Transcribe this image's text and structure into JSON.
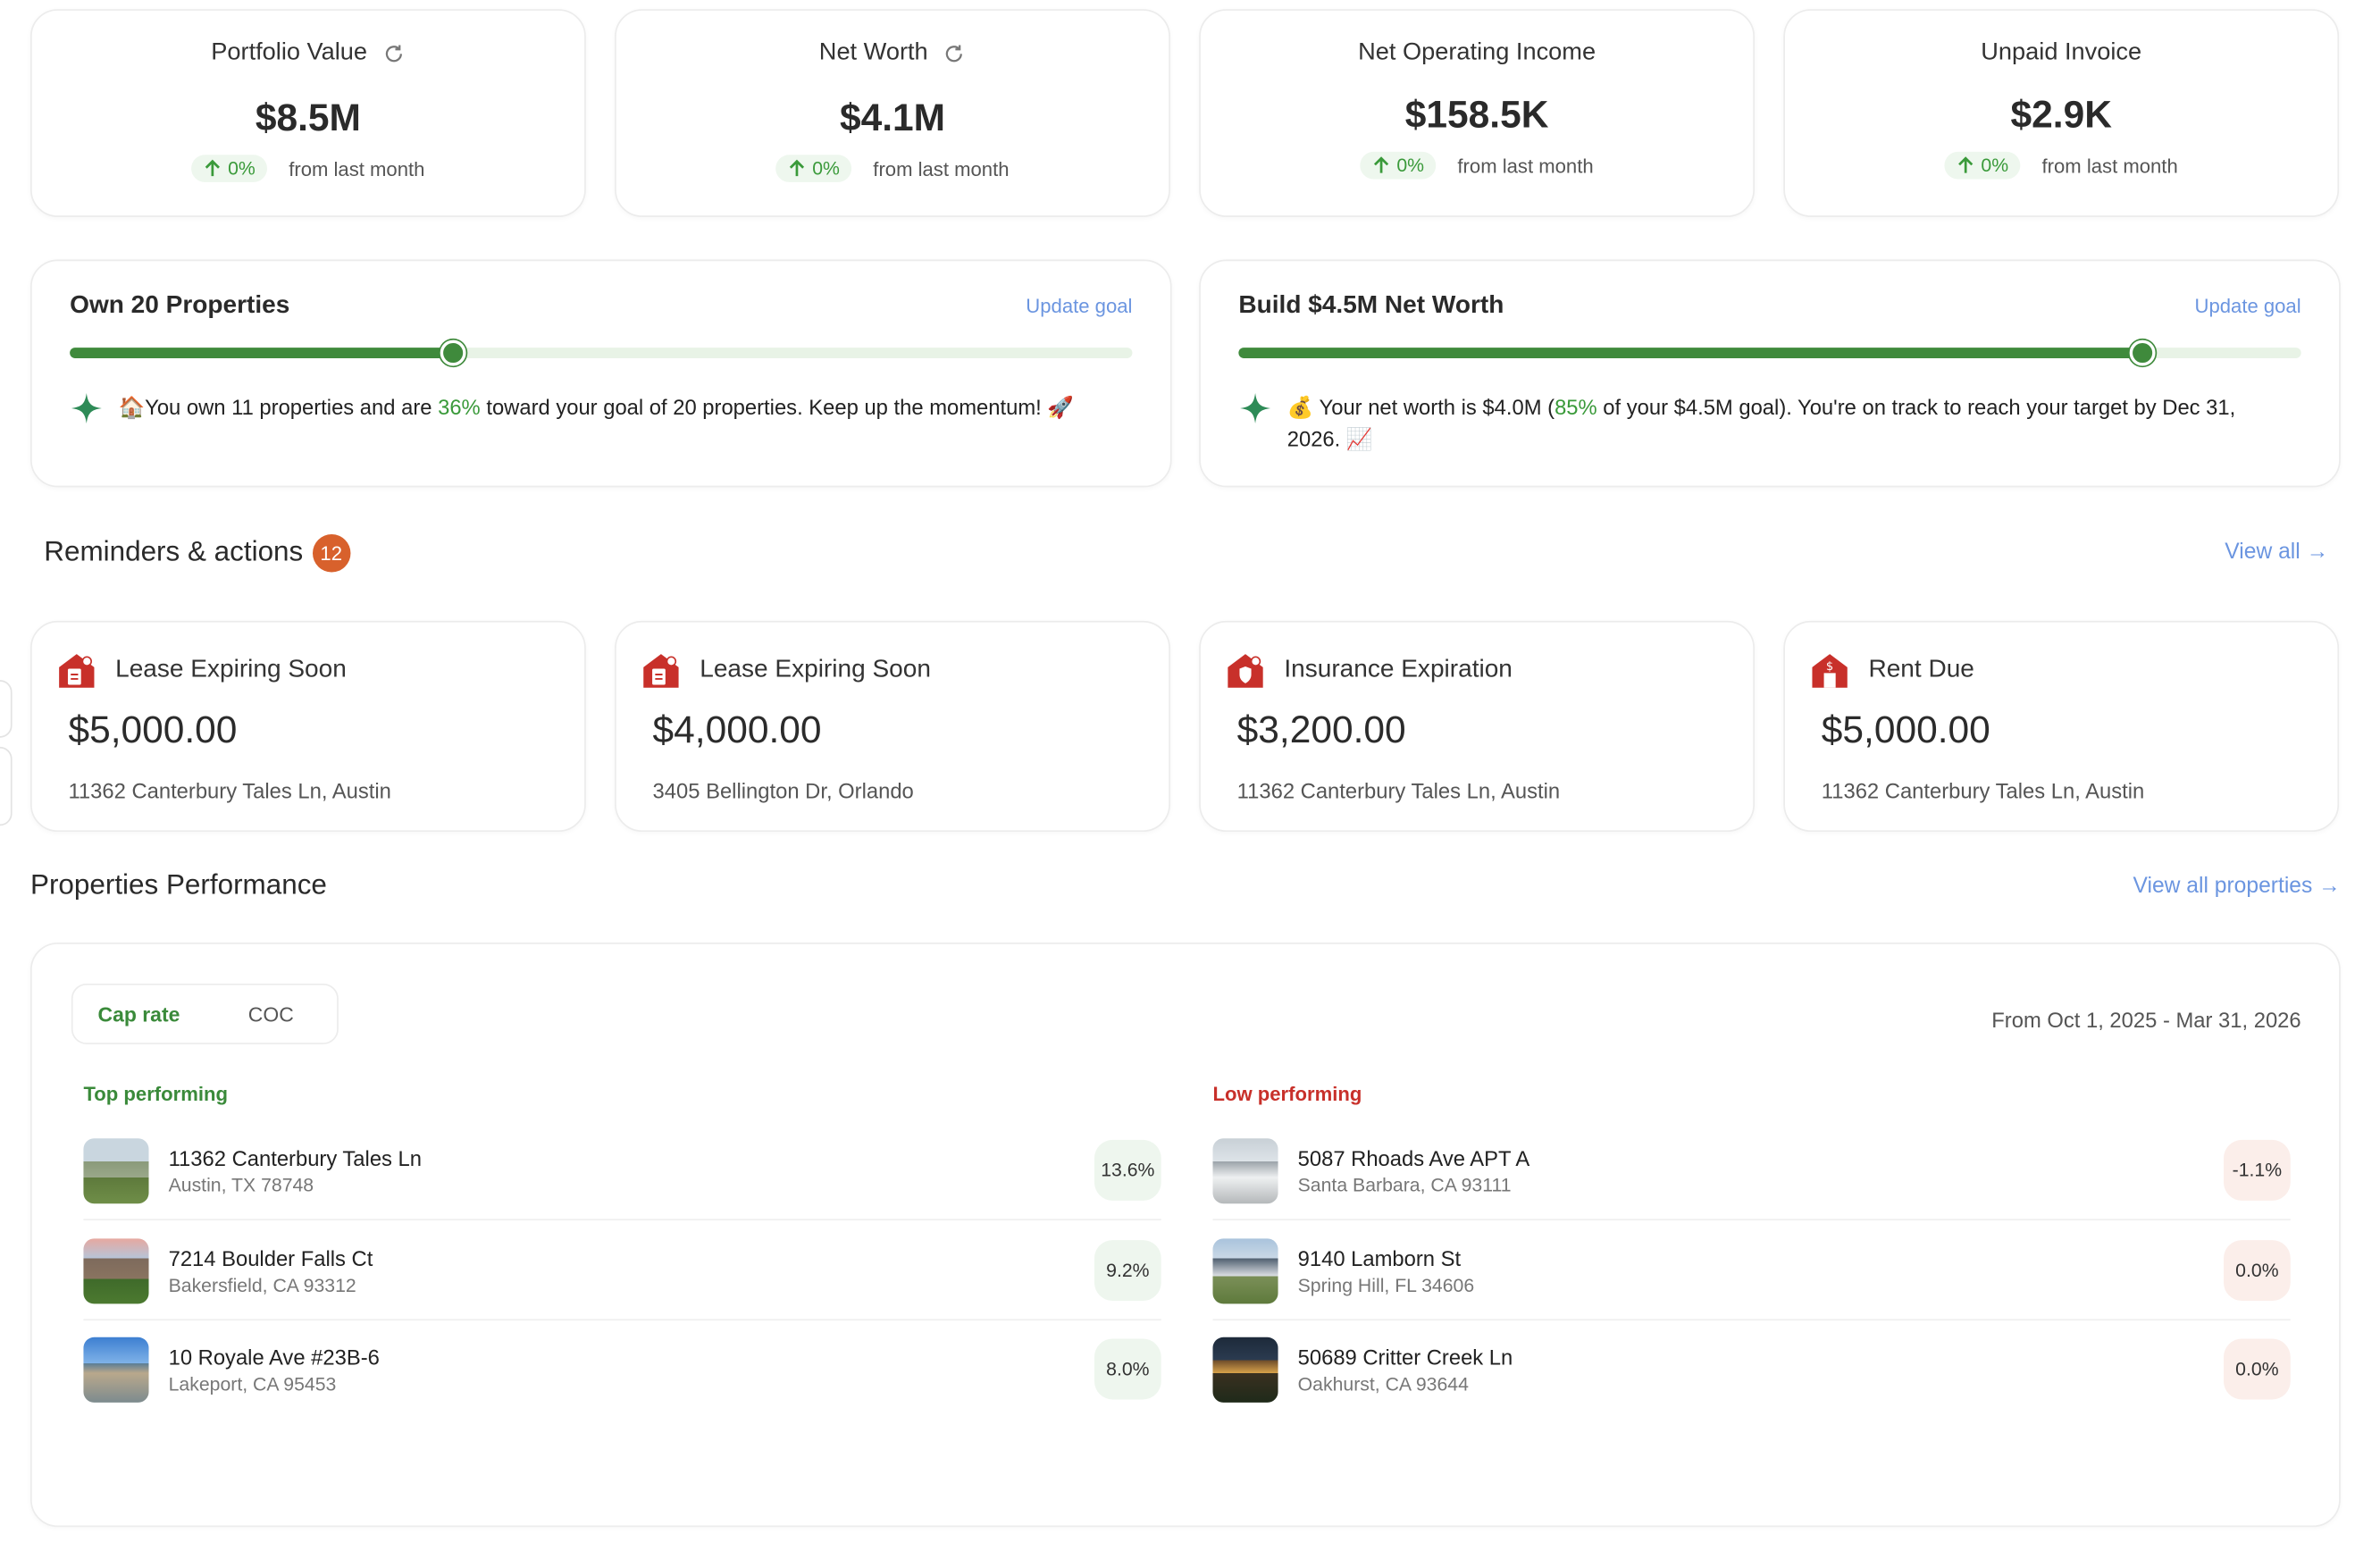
{
  "stats": [
    {
      "title": "Portfolio Value",
      "value": "$8.5M",
      "change": "0%",
      "change_note": "from last month",
      "refresh": true
    },
    {
      "title": "Net Worth",
      "value": "$4.1M",
      "change": "0%",
      "change_note": "from last month",
      "refresh": true
    },
    {
      "title": "Net Operating Income",
      "value": "$158.5K",
      "change": "0%",
      "change_note": "from last month",
      "refresh": false
    },
    {
      "title": "Unpaid Invoice",
      "value": "$2.9K",
      "change": "0%",
      "change_note": "from last month",
      "refresh": false
    }
  ],
  "goals": [
    {
      "title": "Own 20 Properties",
      "link": "Update goal",
      "progress": 0.36,
      "msg_prefix": "🏠You own 11 properties and are ",
      "msg_highlight": "36%",
      "msg_suffix": " toward your goal of 20 properties. Keep up the momentum! 🚀"
    },
    {
      "title": "Build $4.5M Net Worth",
      "link": "Update goal",
      "progress": 0.85,
      "msg_prefix": "💰 Your net worth is $4.0M (",
      "msg_highlight": "85%",
      "msg_suffix": " of your $4.5M goal). You're on track to reach your target by Dec 31, 2026. 📈"
    }
  ],
  "reminders": {
    "title": "Reminders & actions",
    "count": "12",
    "view_all": "View all →",
    "items": [
      {
        "type": "Lease Expiring Soon",
        "amount": "$5,000.00",
        "address": "11362 Canterbury Tales Ln, Austin",
        "icon": "lease-icon"
      },
      {
        "type": "Lease Expiring Soon",
        "amount": "$4,000.00",
        "address": "3405 Bellington Dr, Orlando",
        "icon": "lease-icon"
      },
      {
        "type": "Insurance Expiration",
        "amount": "$3,200.00",
        "address": "11362 Canterbury Tales Ln, Austin",
        "icon": "insurance-icon"
      },
      {
        "type": "Rent Due",
        "amount": "$5,000.00",
        "address": "11362 Canterbury Tales Ln, Austin",
        "icon": "rent-icon"
      }
    ]
  },
  "performance": {
    "title": "Properties Performance",
    "view_all": "View all properties →",
    "tabs": [
      "Cap rate",
      "COC"
    ],
    "active_tab": "Cap rate",
    "range": "From Oct 1, 2025 - Mar 31, 2026",
    "top_label": "Top performing",
    "low_label": "Low performing",
    "top": [
      {
        "line1": "11362 Canterbury Tales Ln",
        "line2": "Austin, TX 78748",
        "pct": "13.6%"
      },
      {
        "line1": "7214 Boulder Falls Ct",
        "line2": "Bakersfield, CA 93312",
        "pct": "9.2%"
      },
      {
        "line1": "10 Royale Ave #23B-6",
        "line2": "Lakeport, CA 95453",
        "pct": "8.0%"
      }
    ],
    "low": [
      {
        "line1": "5087 Rhoads Ave APT A",
        "line2": "Santa Barbara, CA 93111",
        "pct": "-1.1%"
      },
      {
        "line1": "9140 Lamborn St",
        "line2": "Spring Hill, FL 34606",
        "pct": "0.0%"
      },
      {
        "line1": "50689 Critter Creek Ln",
        "line2": "Oakhurst, CA 93644",
        "pct": "0.0%"
      }
    ]
  },
  "colors": {
    "accent_green": "#3f8a3c",
    "link_blue": "#6b95e0",
    "badge_orange": "#d8612c",
    "alert_red": "#c8302a"
  }
}
